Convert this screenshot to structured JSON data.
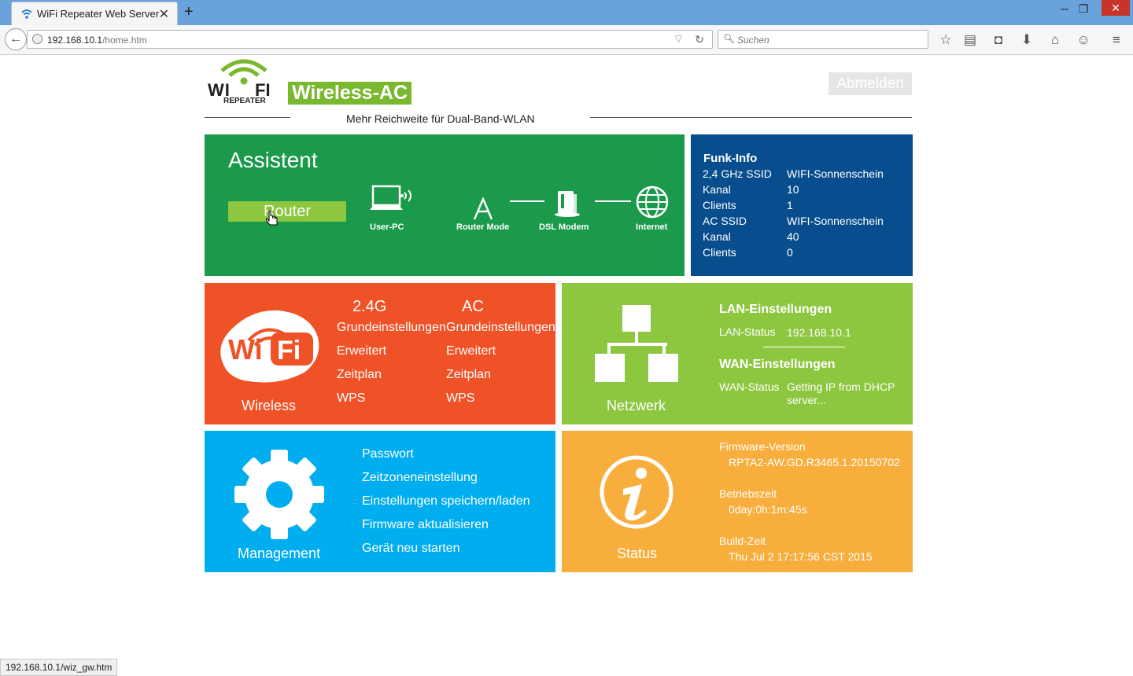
{
  "browser": {
    "tab_title": "WiFi Repeater Web Server",
    "url_host": "192.168.10.1",
    "url_path": "/home.htm",
    "search_placeholder": "Suchen",
    "status_url": "192.168.10.1/wiz_gw.htm"
  },
  "header": {
    "logo_wifi_w": "WI",
    "logo_wifi_f": "FI",
    "logo_repeater": "REPEATER",
    "logo_ac": "Wireless-AC",
    "tagline": "Mehr Reichweite für Dual-Band-WLAN",
    "logout_label": "Abmelden"
  },
  "assistant": {
    "title": "Assistent",
    "router_button": "Router",
    "devices": [
      "User-PC",
      "Router Mode",
      "DSL Modem",
      "Internet"
    ]
  },
  "funk_info": {
    "title": "Funk-Info",
    "rows": [
      {
        "label": "2,4 GHz SSID",
        "value": "WIFI-Sonnenschein"
      },
      {
        "label": "Kanal",
        "value": "10"
      },
      {
        "label": "Clients",
        "value": "1"
      },
      {
        "label": "AC SSID",
        "value": "WIFI-Sonnenschein"
      },
      {
        "label": "Kanal",
        "value": "40"
      },
      {
        "label": "Clients",
        "value": "0"
      }
    ]
  },
  "wireless": {
    "caption": "Wireless",
    "logo_text": "Wi Fi",
    "band24": "2.4G",
    "bandac": "AC",
    "links24": [
      "Grundeinstellungen",
      "Erweitert",
      "Zeitplan",
      "WPS"
    ],
    "linksac": [
      "Grundeinstellungen",
      "Erweitert",
      "Zeitplan",
      "WPS"
    ]
  },
  "network": {
    "caption": "Netzwerk",
    "lan_title": "LAN-Einstellungen",
    "lan_status_label": "LAN-Status",
    "lan_status_value": "192.168.10.1",
    "wan_title": "WAN-Einstellungen",
    "wan_status_label": "WAN-Status",
    "wan_status_value": "Getting IP from DHCP server..."
  },
  "management": {
    "caption": "Management",
    "links": [
      "Passwort",
      "Zeitzoneneinstellung",
      "Einstellungen speichern/laden",
      "Firmware aktualisieren",
      "Gerät neu starten"
    ]
  },
  "status": {
    "caption": "Status",
    "firmware_label": "Firmware-Version",
    "firmware_value": "RPTA2-AW.GD.R3465.1.20150702",
    "uptime_label": "Betriebszeit",
    "uptime_value": "0day:0h:1m:45s",
    "build_label": "Build-Zeit",
    "build_value": "Thu Jul 2 17:17:56 CST 2015"
  },
  "colors": {
    "assistant": "#1a9a4a",
    "funk": "#084e8e",
    "wireless": "#f05227",
    "network": "#8dc63f",
    "management": "#00aeef",
    "status": "#f8ae3d"
  }
}
